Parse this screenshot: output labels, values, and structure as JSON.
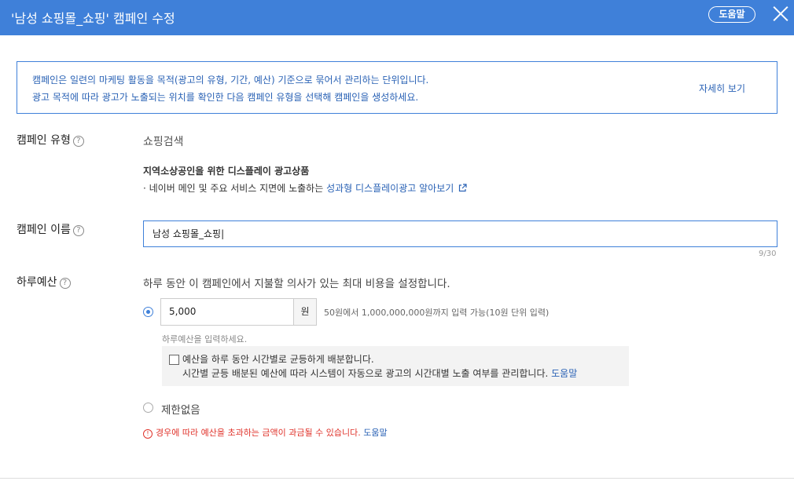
{
  "header": {
    "title": "'남성 쇼핑몰_쇼핑' 캠페인 수정",
    "help_label": "도움말"
  },
  "info": {
    "line1": "캠페인은 일련의 마케팅 활동을 목적(광고의 유형, 기간, 예산) 기준으로 묶어서 관리하는 단위입니다.",
    "line2": "광고 목적에 따라 광고가 노출되는 위치를 확인한 다음 캠페인 유형을 선택해 캠페인을 생성하세요.",
    "more_label": "자세히 보기"
  },
  "campaign_type": {
    "label": "캠페인 유형",
    "value": "쇼핑검색",
    "notice_title": "지역소상공인을 위한 디스플레이 광고상품",
    "notice_text": "· 네이버 메인 및 주요 서비스 지면에 노출하는",
    "notice_link": "성과형 디스플레이광고 알아보기"
  },
  "campaign_name": {
    "label": "캠페인 이름",
    "value": "남성 쇼핑몰_쇼핑|",
    "counter": "9/30"
  },
  "daily_budget": {
    "label": "하루예산",
    "description": "하루 동안 이 캠페인에서 지불할 의사가 있는 최대 비용을 설정합니다.",
    "amount": "5,000",
    "unit": "원",
    "range_hint": "50원에서 1,000,000,000원까지 입력 가능(10원 단위 입력)",
    "input_hint": "하루예산을 입력하세요.",
    "even_label": "예산을 하루 동안 시간별로 균등하게 배분합니다.",
    "even_desc": "시간별 균등 배분된 예산에 따라 시스템이 자동으로 광고의 시간대별 노출 여부를 관리합니다.",
    "even_help": "도움말",
    "unlimited_label": "제한없음",
    "warning": "경우에 따라 예산을 초과하는 금액이 과금될 수 있습니다.",
    "warning_help": "도움말"
  },
  "icons": {
    "help": "question-mark",
    "external_link": "external-link-icon",
    "warning": "exclamation-icon"
  },
  "colors": {
    "accent": "#3f80d9",
    "link": "#2a62b5",
    "warning": "#e0342c"
  }
}
